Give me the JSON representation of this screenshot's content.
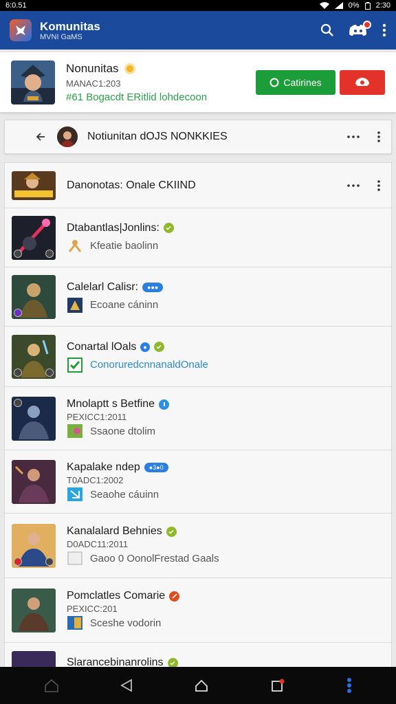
{
  "status_bar": {
    "time_left": "6:0.51",
    "battery": "0%",
    "time_right": "2:30"
  },
  "app_bar": {
    "title": "Komunitas",
    "subtitle": "MVNI GaMS"
  },
  "profile": {
    "name": "Nonunitas",
    "meta": "MANAC1:203",
    "link": "#61 Bogacdt ERitlid lohdecoon",
    "primary_button": "Catirines"
  },
  "chat_header": {
    "title": "Notiunitan dOJS NONKKIES"
  },
  "list": {
    "header_title": "Danonotas: Onale CKIIND",
    "items": [
      {
        "title": "Dtabantlas|Jonlins:",
        "badge": "green",
        "date": "",
        "sub": "Kfeatie baolinn",
        "sub_style": "normal"
      },
      {
        "title": "Calelarl Calisr:",
        "pill": "●●●",
        "date": "",
        "sub": "Ecoane cáninn",
        "sub_style": "normal"
      },
      {
        "title": "Conartal lOals",
        "badge": "green",
        "pill_small": "●",
        "date": "",
        "sub": "ConoruredcnnanaldOnale",
        "sub_style": "blue"
      },
      {
        "title": "Mnolaptt s Betfine",
        "badge": "blue",
        "date": "PEXICC1:2011",
        "sub": "Ssaone dtolim",
        "sub_style": "normal"
      },
      {
        "title": "Kapalake ndep",
        "pill": "●3●0",
        "date": "T0ADC1:2002",
        "sub": "Seaohe cáuinn",
        "sub_style": "normal"
      },
      {
        "title": "Kanalalard Behnies",
        "badge": "green",
        "date": "D0ADC11:2011",
        "sub": "Gaoo 0 OonolFrestad Gaals",
        "sub_style": "normal"
      },
      {
        "title": "Pomclatles Comarie",
        "badge": "red",
        "date": "PEXICC:201",
        "sub": "Sceshe vodorin",
        "sub_style": "normal"
      },
      {
        "title": "Slarancebinanrolins",
        "badge": "green",
        "date": "",
        "sub": "",
        "sub_style": "normal"
      }
    ]
  },
  "colors": {
    "app_bar": "#1b4a9c",
    "green_button": "#1d9d3a",
    "red_button": "#e2322a",
    "badge_green": "#8fb92a",
    "badge_blue": "#2b8fe3",
    "badge_red": "#e14b22",
    "link_green": "#2aa14a"
  },
  "icons": {
    "app_bar": [
      "search-icon",
      "discord-icon",
      "more-vert-icon"
    ],
    "nav": [
      "home-icon",
      "back-icon",
      "home-circle-icon",
      "recents-icon",
      "menu-icon"
    ]
  }
}
